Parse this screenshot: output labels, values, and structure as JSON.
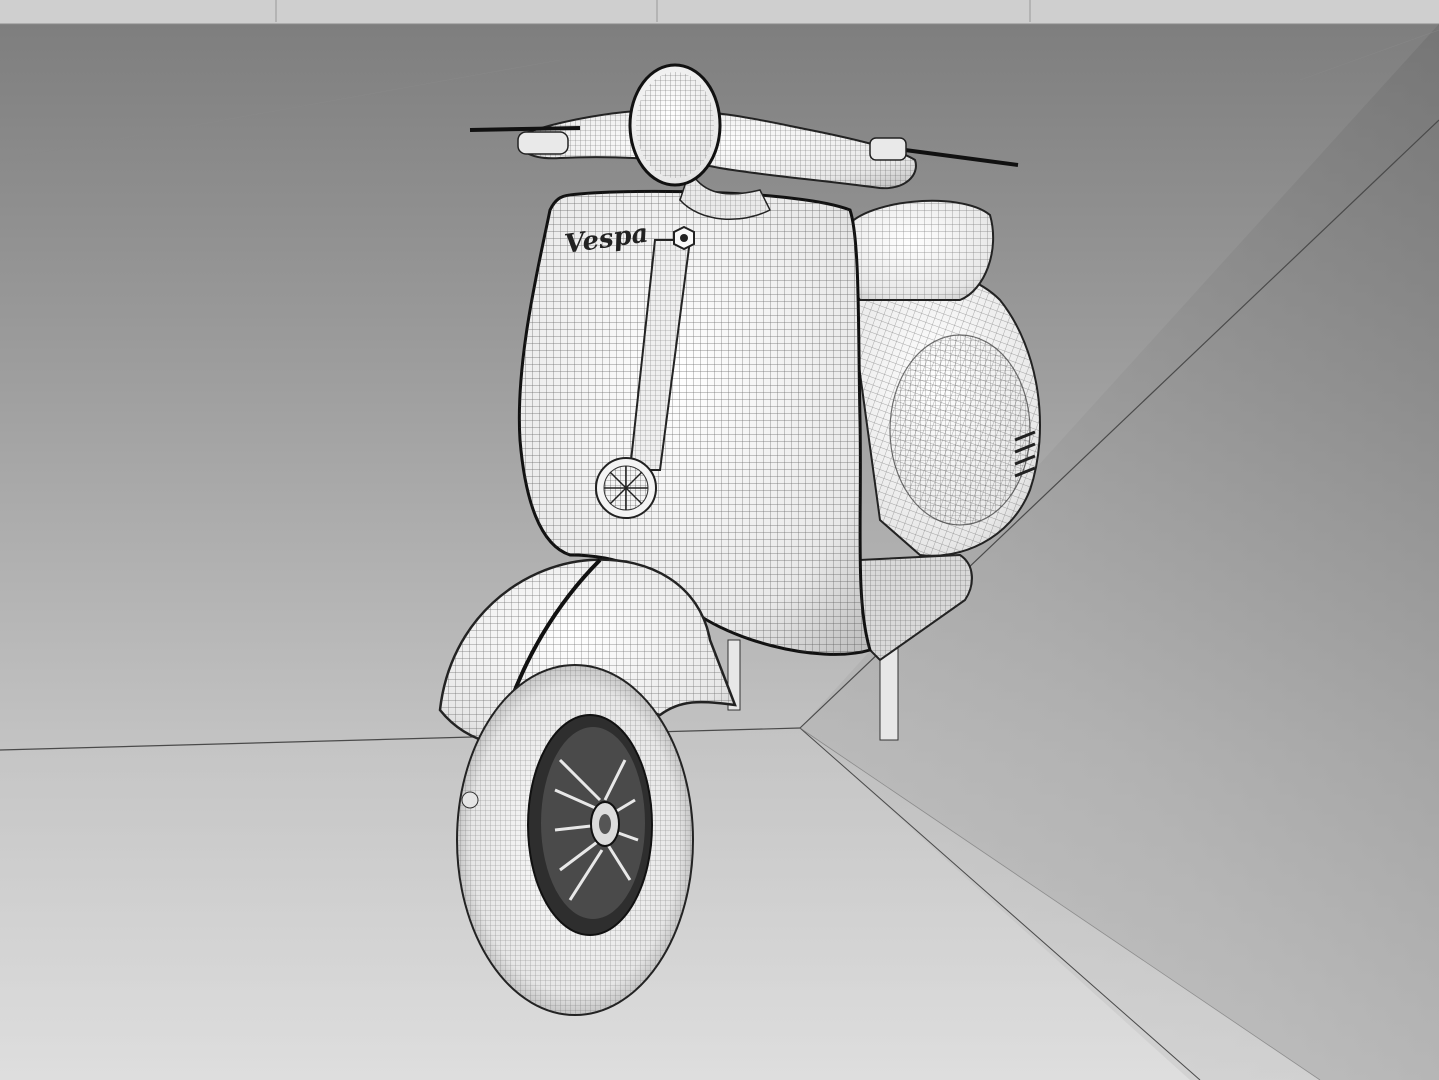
{
  "scene": {
    "brand_lettering": "Vespa",
    "colors": {
      "backdrop_top": "#8c8c8c",
      "backdrop_mid": "#a8a8a8",
      "floor_light": "#dcdcdc",
      "floor_mid": "#c2c2c2",
      "wire": "#2a2a2a",
      "shell": "#f1f1f1",
      "shadow": "#9a9a9a"
    },
    "icons": {
      "viewport": "wireframe-scooter-render"
    }
  }
}
